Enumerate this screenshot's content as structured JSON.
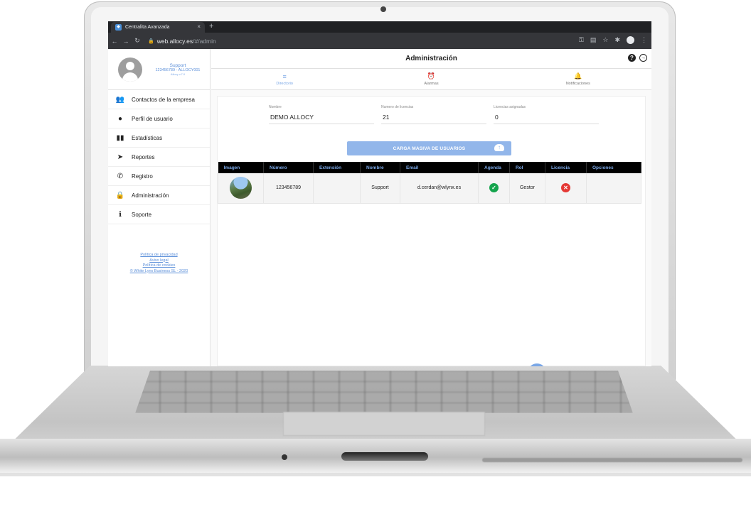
{
  "browser": {
    "tab_title": "Centralita Avanzada",
    "tab_close": "×",
    "new_tab": "+",
    "url_host": "web.allocy.es",
    "url_path": "/#/admin"
  },
  "profile": {
    "name": "Support",
    "line": "123456789 - ALLOCY001",
    "version": "Allocy v.7.0"
  },
  "sidebar": {
    "items": [
      {
        "label": "Contactos de la empresa",
        "icon": "contacts-icon"
      },
      {
        "label": "Perfil de usuario",
        "icon": "user-profile-icon"
      },
      {
        "label": "Estadísticas",
        "icon": "bar-chart-icon"
      },
      {
        "label": "Reportes",
        "icon": "send-icon"
      },
      {
        "label": "Registro",
        "icon": "phone-icon"
      },
      {
        "label": "Administración",
        "icon": "lock-icon"
      },
      {
        "label": "Soporte",
        "icon": "info-icon"
      }
    ],
    "legal": [
      "Política de privacidad",
      "Aviso legal",
      "Política de cookies",
      "© White Lynx Business SL - 2020"
    ]
  },
  "header": {
    "title": "Administración"
  },
  "tabs": [
    {
      "label": "Directorio",
      "icon": "list-icon",
      "active": true
    },
    {
      "label": "Alarmas",
      "icon": "alarm-clock-icon",
      "active": false
    },
    {
      "label": "Notificaciones",
      "icon": "bell-icon",
      "active": false
    }
  ],
  "fields": [
    {
      "label": "Nombre",
      "value": "DEMO ALLOCY"
    },
    {
      "label": "Numero de licencias",
      "value": "21"
    },
    {
      "label": "Licencias asignadas",
      "value": "0"
    }
  ],
  "upload_button": "CARGA MASIVA DE USUARIOS",
  "table": {
    "headers": [
      "Imagen",
      "Número",
      "Extensión",
      "Nombre",
      "Email",
      "Agenda",
      "Rol",
      "Licencia",
      "Opciones"
    ],
    "rows": [
      {
        "numero": "123456789",
        "extension": "",
        "nombre": "Support",
        "email": "d.cerdan@wlynx.es",
        "agenda": true,
        "rol": "Gestor",
        "licencia": false,
        "opciones": ""
      }
    ]
  },
  "colors": {
    "accent": "#7aa7e6",
    "ok": "#14a44d",
    "error": "#e53935"
  }
}
